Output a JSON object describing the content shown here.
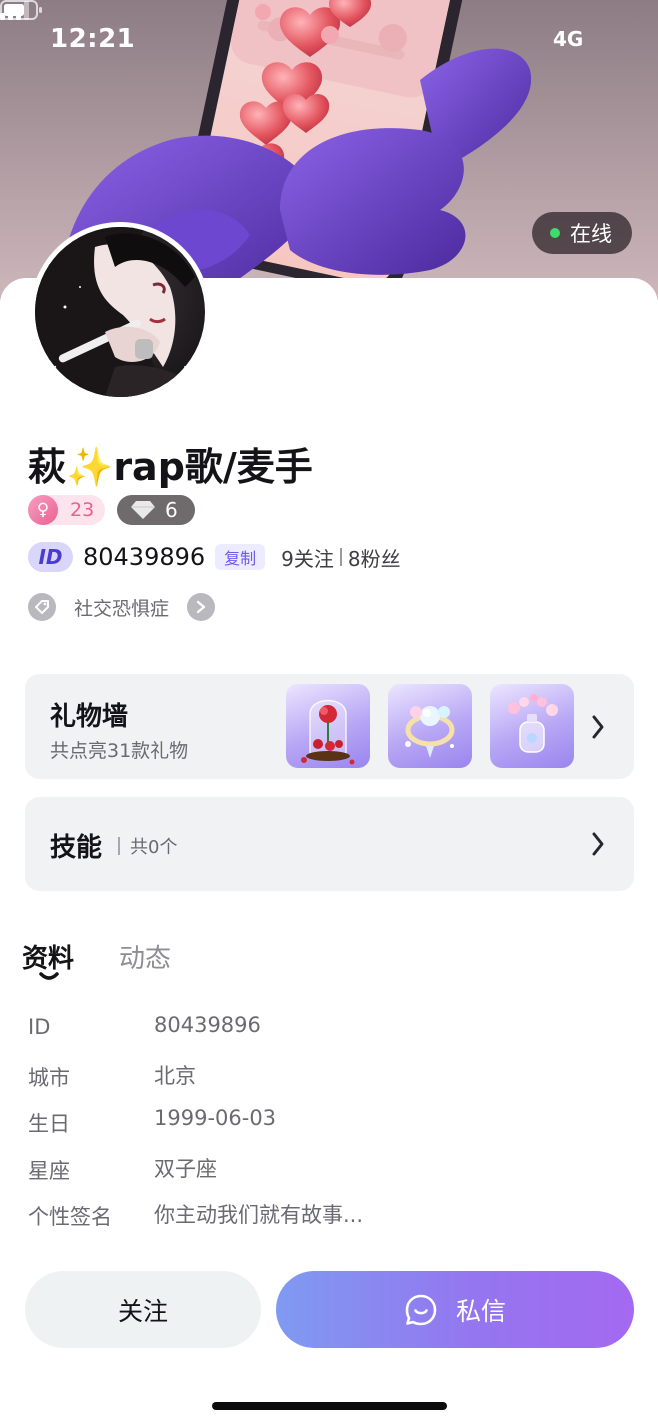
{
  "status_bar": {
    "time": "12:21",
    "network": "4G",
    "icons": [
      "signal-icon",
      "battery-icon"
    ]
  },
  "header": {
    "online_status": "在线",
    "online_color": "#3ddc6b"
  },
  "profile": {
    "nickname": "萩✨rap歌/麦手",
    "level_badge": "23",
    "diamond_badge": "6",
    "id_label": "ID",
    "id_number": "80439896",
    "copy_label": "复制",
    "following": "9关注",
    "followers": "8粉丝",
    "tag": "社交恐惧症"
  },
  "gift_wall": {
    "title": "礼物墙",
    "subtitle": "共点亮31款礼物",
    "gifts": [
      "rose-in-glass-gift",
      "crystal-ring-gift",
      "flower-perfume-gift"
    ]
  },
  "skills": {
    "title": "技能",
    "count": "共0个"
  },
  "tabs": [
    {
      "label": "资料",
      "active": true
    },
    {
      "label": "动态",
      "active": false
    }
  ],
  "info": [
    {
      "key": "ID",
      "value": "80439896"
    },
    {
      "key": "城市",
      "value": "北京"
    },
    {
      "key": "生日",
      "value": "1999-06-03"
    },
    {
      "key": "星座",
      "value": "双子座"
    },
    {
      "key": "个性签名",
      "value": "你主动我们就有故事..."
    }
  ],
  "actions": {
    "follow": "关注",
    "message": "私信"
  },
  "colors": {
    "accent_purple": "#9476f0",
    "accent_blue": "#7f9af1",
    "level_pink": "#ec5d91",
    "card_bg": "#f0f2f4"
  }
}
